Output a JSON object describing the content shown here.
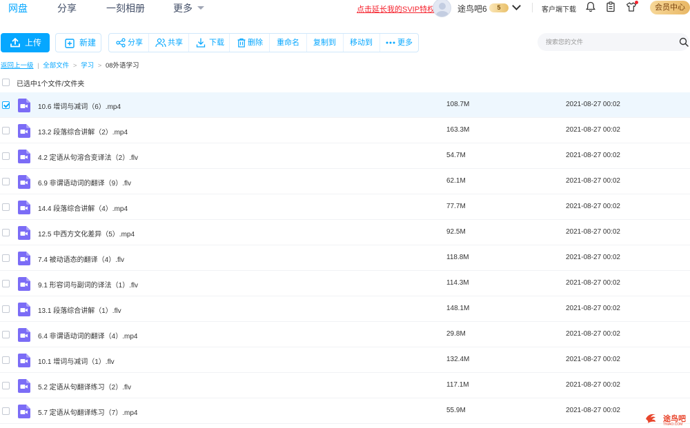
{
  "nav": {
    "tabs": [
      {
        "label": "网盘"
      },
      {
        "label": "分享"
      },
      {
        "label": "一刻相册"
      },
      {
        "label": "更多"
      }
    ],
    "svip_link": "点击延长我的SVIP特权",
    "username": "途鸟吧6",
    "vip_badge": "5",
    "client_download": "客户端下载",
    "member_center": "会员中心"
  },
  "toolbar": {
    "upload": "上传",
    "new": "新建",
    "share": "分享",
    "co_share": "共享",
    "download": "下载",
    "delete": "删除",
    "rename": "重命名",
    "copy_to": "复制到",
    "move_to": "移动到",
    "more": "更多"
  },
  "search": {
    "placeholder": "搜索您的文件"
  },
  "breadcrumb": {
    "back": "返回上一级",
    "all_files": "全部文件",
    "level1": "学习",
    "current": "08外语学习",
    "separator": ">"
  },
  "selection_summary": "已选中1个文件/文件夹",
  "files": [
    {
      "name": "10.6 增词与减词（6）.mp4",
      "size": "108.7M",
      "date": "2021-08-27 00:02",
      "selected": true
    },
    {
      "name": "13.2 段落综合讲解（2）.mp4",
      "size": "163.3M",
      "date": "2021-08-27 00:02",
      "selected": false
    },
    {
      "name": "4.2 定语从句溶合变译法（2）.flv",
      "size": "54.7M",
      "date": "2021-08-27 00:02",
      "selected": false
    },
    {
      "name": "6.9 非谓语动词的翻译（9）.flv",
      "size": "62.1M",
      "date": "2021-08-27 00:02",
      "selected": false
    },
    {
      "name": "14.4 段落综合讲解（4）.mp4",
      "size": "77.7M",
      "date": "2021-08-27 00:02",
      "selected": false
    },
    {
      "name": "12.5 中西方文化差异（5）.mp4",
      "size": "92.5M",
      "date": "2021-08-27 00:02",
      "selected": false
    },
    {
      "name": "7.4 被动语态的翻译（4）.flv",
      "size": "118.8M",
      "date": "2021-08-27 00:02",
      "selected": false
    },
    {
      "name": "9.1 形容词与副词的译法（1）.flv",
      "size": "114.3M",
      "date": "2021-08-27 00:02",
      "selected": false
    },
    {
      "name": "13.1 段落综合讲解（1）.flv",
      "size": "148.1M",
      "date": "2021-08-27 00:02",
      "selected": false
    },
    {
      "name": "6.4 非谓语动词的翻译（4）.mp4",
      "size": "29.8M",
      "date": "2021-08-27 00:02",
      "selected": false
    },
    {
      "name": "10.1 增词与减词（1）.flv",
      "size": "132.4M",
      "date": "2021-08-27 00:02",
      "selected": false
    },
    {
      "name": "5.2 定语从句翻译练习（2）.flv",
      "size": "117.1M",
      "date": "2021-08-27 00:02",
      "selected": false
    },
    {
      "name": "5.7 定语从句翻译练习（7）.mp4",
      "size": "55.9M",
      "date": "2021-08-27 00:02",
      "selected": false
    }
  ],
  "watermark": {
    "title": "途鸟吧",
    "sub": "TNIAO.COM"
  },
  "colors": {
    "accent": "#06a7ff",
    "svip": "#f5222d",
    "file_icon": "#7b6cf6",
    "selected_row": "#eef7fe"
  }
}
